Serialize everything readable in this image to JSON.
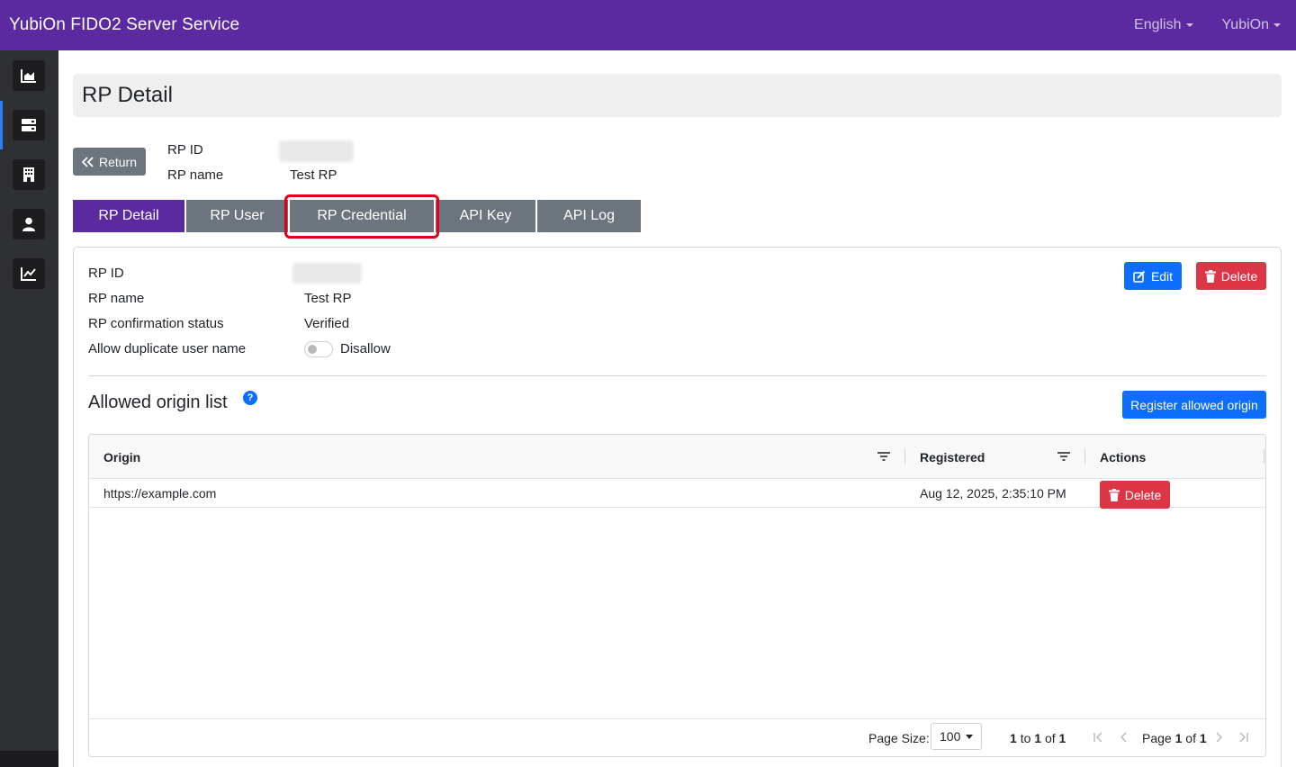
{
  "navbar": {
    "brand": "YubiOn FIDO2 Server Service",
    "language": "English",
    "user": "YubiOn"
  },
  "sidebar": {
    "items": [
      {
        "icon": "area-chart-icon"
      },
      {
        "icon": "server-icon",
        "active": true
      },
      {
        "icon": "building-icon"
      },
      {
        "icon": "user-icon"
      },
      {
        "icon": "line-chart-icon"
      }
    ]
  },
  "page": {
    "title": "RP Detail",
    "return_label": "Return",
    "rp_id_label": "RP ID",
    "rp_name_label": "RP name",
    "rp_name_value": "Test RP"
  },
  "tabs": [
    {
      "label": "RP Detail",
      "active": true
    },
    {
      "label": "RP User"
    },
    {
      "label": "RP Credential",
      "highlighted": true
    },
    {
      "label": "API Key"
    },
    {
      "label": "API Log"
    }
  ],
  "detail": {
    "rp_id_label": "RP ID",
    "rp_name_label": "RP name",
    "rp_name_value": "Test RP",
    "status_label": "RP confirmation status",
    "status_value": "Verified",
    "dup_label": "Allow duplicate user name",
    "dup_value": "Disallow",
    "edit_label": "Edit",
    "delete_label": "Delete"
  },
  "origins": {
    "title": "Allowed origin list",
    "help": "?",
    "register_label": "Register allowed origin",
    "columns": {
      "origin": "Origin",
      "registered": "Registered",
      "actions": "Actions"
    },
    "rows": [
      {
        "origin": "https://example.com",
        "registered": "Aug 12, 2025, 2:35:10 PM",
        "action": "Delete"
      }
    ],
    "footer": {
      "page_size_label": "Page Size:",
      "page_size": "100",
      "range_from": "1",
      "range_to_word": "to",
      "range_to": "1",
      "range_of_word": "of",
      "range_total": "1",
      "page_word": "Page",
      "page_current": "1",
      "page_of_word": "of",
      "page_total": "1"
    }
  },
  "colors": {
    "brand": "#5b2aa0",
    "primary": "#0d6efd",
    "danger": "#dc3545",
    "secondary": "#6c757d",
    "highlight": "#e0001b"
  }
}
